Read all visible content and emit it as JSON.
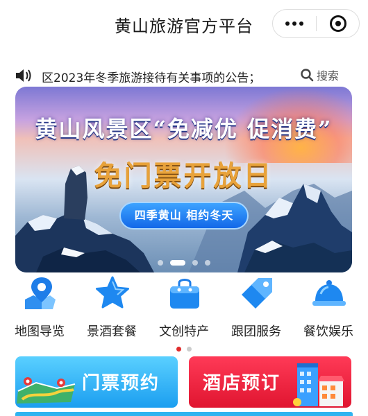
{
  "header": {
    "title": "黄山旅游官方平台"
  },
  "notice": {
    "text": "区2023年冬季旅游接待有关事项的公告；",
    "search_label": "搜索"
  },
  "banner": {
    "title": "黄山风景区“免减优 促消费”",
    "subtitle": "免门票开放日",
    "pill": "四季黄山  相约冬天",
    "slide_count": 4,
    "active_slide": 2
  },
  "quick_nav": {
    "items": [
      {
        "label": "地图导览",
        "icon": "map-pin-icon"
      },
      {
        "label": "景酒套餐",
        "icon": "star-icon"
      },
      {
        "label": "文创特产",
        "icon": "shopping-bag-icon"
      },
      {
        "label": "跟团服务",
        "icon": "tag-icon"
      },
      {
        "label": "餐饮娱乐",
        "icon": "food-cloche-icon"
      }
    ],
    "page_count": 2,
    "active_page": 1
  },
  "cards": {
    "ticket_label": "门票预约",
    "hotel_label": "酒店预订"
  },
  "colors": {
    "accent_blue": "#1e88e5",
    "ticket_card": "#1b9ef0",
    "hotel_card": "#e01530",
    "indicator_active": "#e02b2b"
  }
}
